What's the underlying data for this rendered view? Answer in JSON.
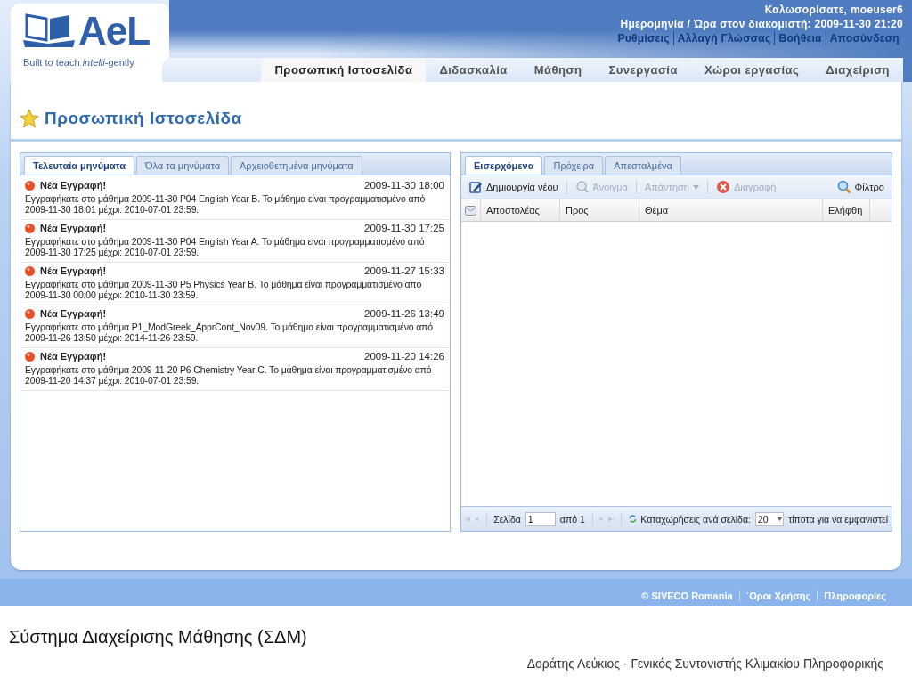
{
  "header": {
    "logo_text": "AeL",
    "tagline": "Built to teach *intelli*-gently",
    "welcome": "Καλωσορίσατε, moeuser6",
    "server_time": "Ημερομηνία / Ώρα στον διακομιστή: 2009-11-30 21:20",
    "user_links": [
      "Ρυθμίσεις",
      "Αλλαγή Γλώσσας",
      "Βοήθεια",
      "Αποσύνδεση"
    ]
  },
  "nav_tabs": [
    {
      "label": "Προσωπική Ιστοσελίδα",
      "selected": true
    },
    {
      "label": "Διδασκαλία",
      "selected": false
    },
    {
      "label": "Μάθηση",
      "selected": false
    },
    {
      "label": "Συνεργασία",
      "selected": false
    },
    {
      "label": "Χώροι εργασίας",
      "selected": false
    },
    {
      "label": "Διαχείριση",
      "selected": false
    }
  ],
  "page_title": "Προσωπική Ιστοσελίδα",
  "messages_panel": {
    "tabs": [
      {
        "label": "Τελευταία μηνύματα",
        "selected": true
      },
      {
        "label": "Όλα τα μηνύματα",
        "selected": false
      },
      {
        "label": "Αρχειοθετημένα μηνύματα",
        "selected": false
      }
    ],
    "messages": [
      {
        "title": "Νέα Εγγραφή!",
        "date": "2009-11-30 18:00",
        "body": "Εγγραφήκατε στο μάθημα 2009-11-30 P04 English Year B. Το μάθημα είναι προγραμματισμένο από 2009-11-30 18:01 μέχρι: 2010-07-01 23:59."
      },
      {
        "title": "Νέα Εγγραφή!",
        "date": "2009-11-30 17:25",
        "body": "Εγγραφήκατε στο μάθημα 2009-11-30 P04 English Year A. Το μάθημα είναι προγραμματισμένο από 2009-11-30 17:25 μέχρι: 2010-07-01 23:59."
      },
      {
        "title": "Νέα Εγγραφή!",
        "date": "2009-11-27 15:33",
        "body": "Εγγραφήκατε στο μάθημα 2009-11-30 P5 Physics Year B. Το μάθημα είναι προγραμματισμένο από 2009-11-30 00:00 μέχρι: 2010-11-30 23:59."
      },
      {
        "title": "Νέα Εγγραφή!",
        "date": "2009-11-26 13:49",
        "body": "Εγγραφήκατε στο μάθημα P1_ModGreek_ApprCont_Nov09. Το μάθημα είναι προγραμματισμένο από 2009-11-26 13:50 μέχρι: 2014-11-26 23:59."
      },
      {
        "title": "Νέα Εγγραφή!",
        "date": "2009-11-20 14:26",
        "body": "Εγγραφήκατε στο μάθημα 2009-11-20 P6 Chemistry Year C. Το μάθημα είναι προγραμματισμένο από 2009-11-20 14:37 μέχρι: 2010-07-01 23:59."
      }
    ]
  },
  "mail_panel": {
    "tabs": [
      {
        "label": "Εισερχόμενα",
        "selected": true
      },
      {
        "label": "Πρόχειρα",
        "selected": false
      },
      {
        "label": "Απεσταλμένα",
        "selected": false
      }
    ],
    "toolbar": [
      {
        "kind": "create",
        "label": "Δημιουργία νέου",
        "disabled": false
      },
      {
        "kind": "open",
        "label": "Άνοιγμα",
        "disabled": true
      },
      {
        "kind": "reply",
        "label": "Απάντηση",
        "disabled": true
      },
      {
        "kind": "delete",
        "label": "Διαγραφή",
        "disabled": true
      }
    ],
    "filter": "Φίλτρο",
    "columns": [
      "Αποστολέας",
      "Προς",
      "Θέμα",
      "Ελήφθη"
    ],
    "pager": {
      "page_label": "Σελίδα",
      "page": "1",
      "of": "από 1",
      "per_page_label": "Καταχωρήσεις ανά σελίδα:",
      "per_page": "20",
      "empty": "τίποτα για να εμφανιστεί"
    }
  },
  "footer": {
    "links": [
      "© SIVECO Romania",
      "΄Οροι Χρήσης",
      "Πληροφορίες"
    ]
  },
  "slide": {
    "title": "Σύστημα Διαχείρισης Μάθησης (ΣΔΜ)",
    "author": "Δοράτης Λεύκιος - Γενικός Συντονιστής Κλιμακίου Πληροφορικής"
  }
}
